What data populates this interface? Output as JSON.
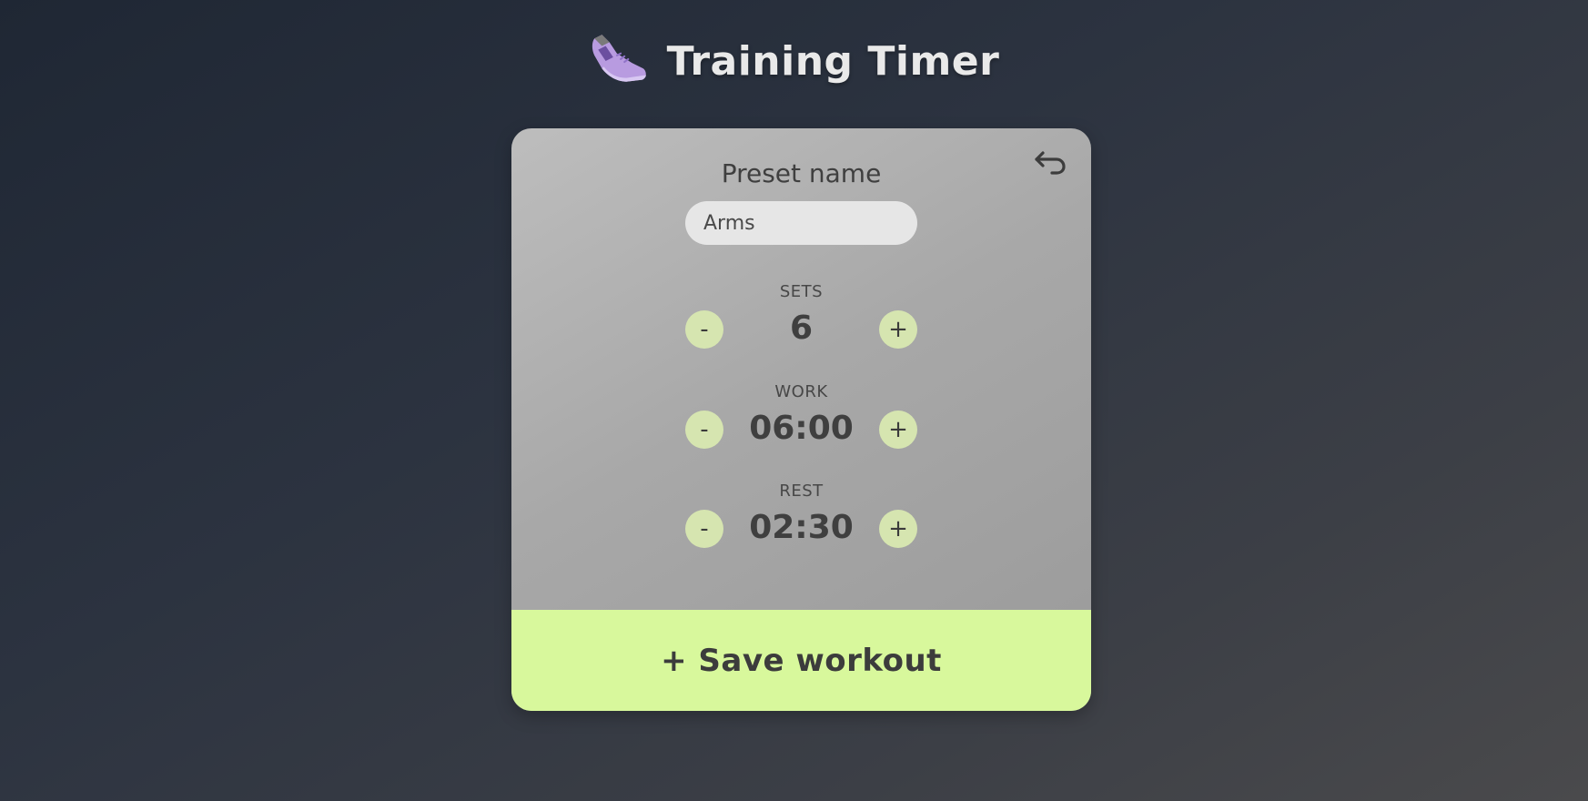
{
  "header": {
    "title": "Training Timer",
    "icon": "running-shoe-icon"
  },
  "card": {
    "back_icon": "return-arrow-icon",
    "preset_label": "Preset name",
    "preset_value": "Arms",
    "fields": [
      {
        "label": "SETS",
        "value": "6",
        "minus": "-",
        "plus": "+"
      },
      {
        "label": "WORK",
        "value": "06:00",
        "minus": "-",
        "plus": "+"
      },
      {
        "label": "REST",
        "value": "02:30",
        "minus": "-",
        "plus": "+"
      }
    ],
    "save_label": "+ Save workout"
  },
  "colors": {
    "accent": "#d8f89c",
    "stepper": "#d6e5b0",
    "shoe": "#b89be0"
  }
}
